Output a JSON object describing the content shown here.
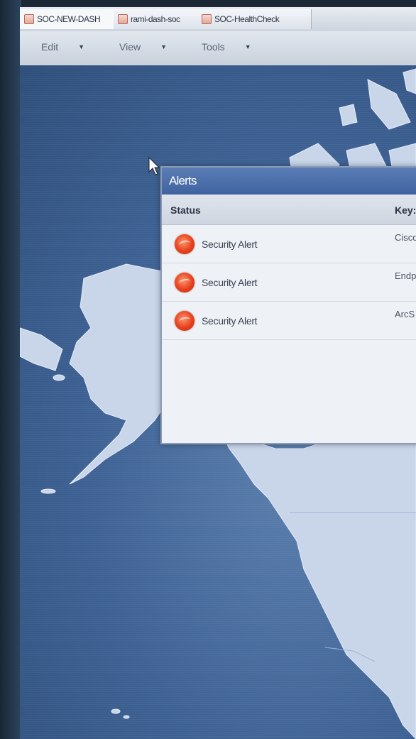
{
  "tabs": [
    {
      "label": "SOC-NEW-DASH",
      "active": true
    },
    {
      "label": "rami-dash-soc",
      "active": false
    },
    {
      "label": "SOC-HealthCheck",
      "active": false
    }
  ],
  "menu": {
    "edit": "Edit",
    "view": "View",
    "tools": "Tools",
    "caret": "▼"
  },
  "alerts": {
    "title": "Alerts",
    "columns": {
      "status": "Status",
      "key": "Key:"
    },
    "rows": [
      {
        "status": "Security Alert",
        "key": "Cisco"
      },
      {
        "status": "Security Alert",
        "key": "Endp"
      },
      {
        "status": "Security Alert",
        "key": "ArcS"
      }
    ],
    "status_color": "#e8401c"
  },
  "colors": {
    "title_bar": "#4a6eab",
    "map_ocean": "#3d6193",
    "map_land": "#c9d6ea"
  }
}
